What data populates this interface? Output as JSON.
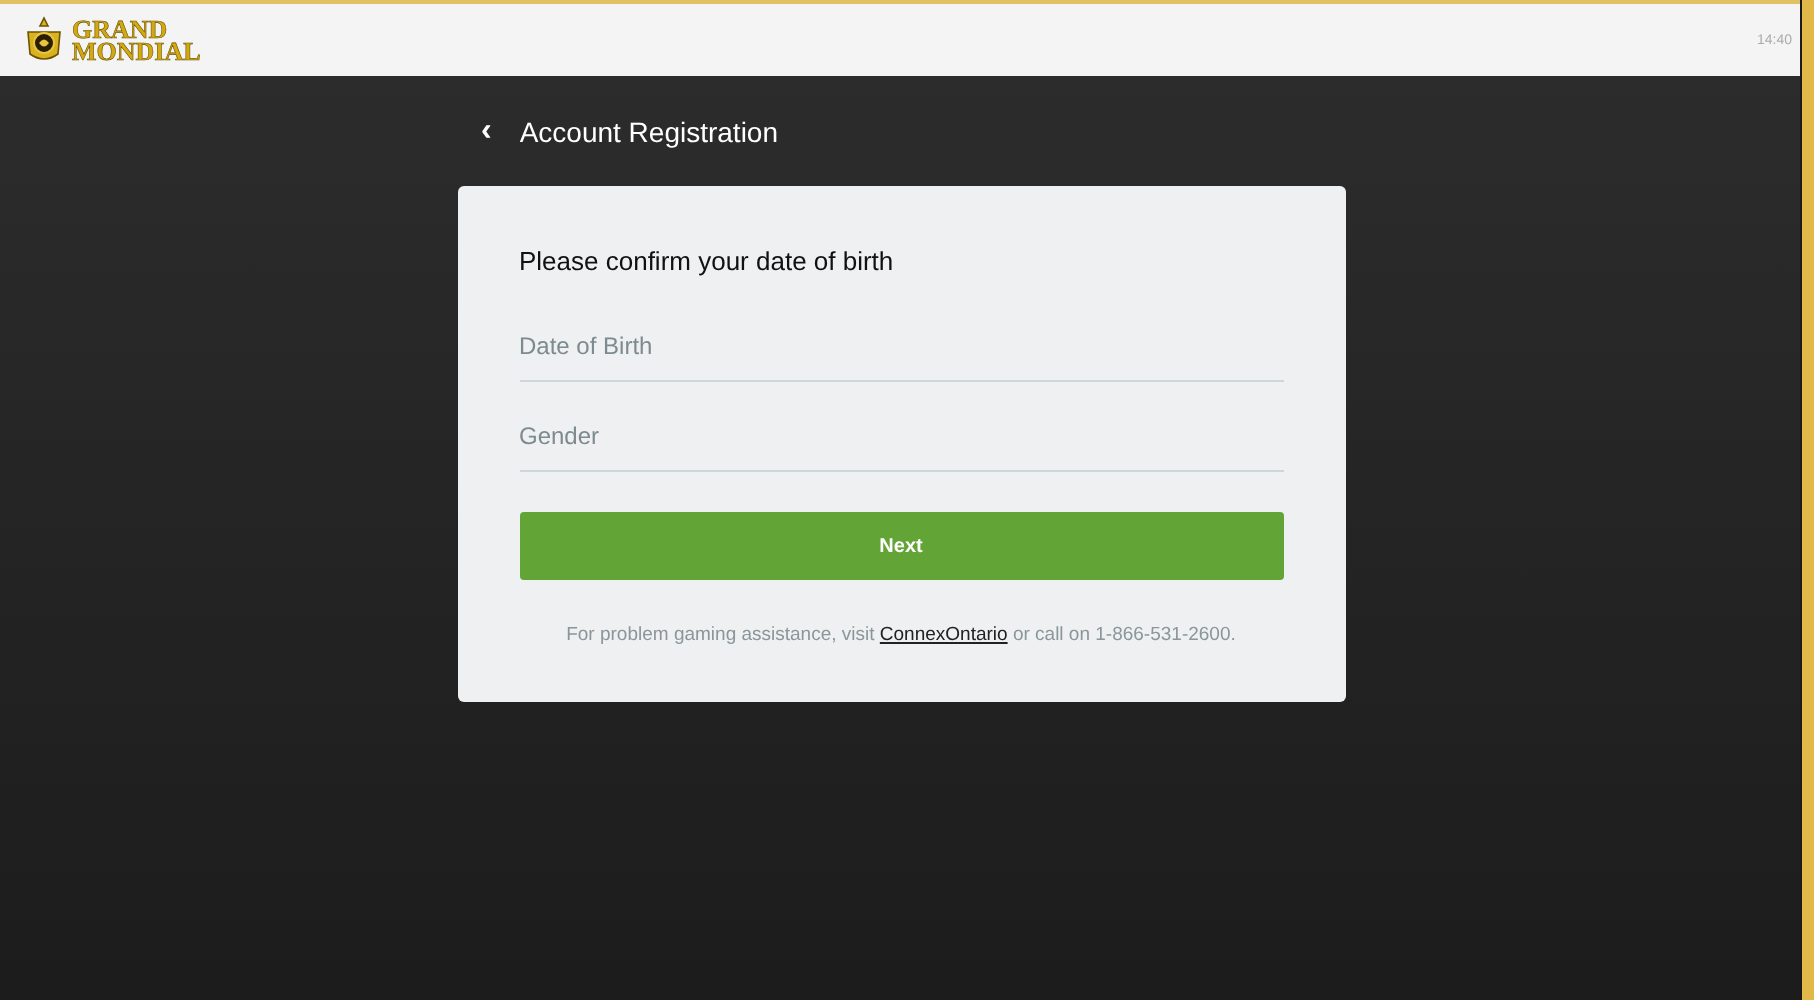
{
  "header": {
    "logo_lines": [
      "GRAND",
      "MONDIAL"
    ],
    "time": "14:40"
  },
  "page": {
    "title": "Account Registration",
    "back": "‹"
  },
  "form": {
    "heading": "Please confirm your date of birth",
    "fields": [
      {
        "placeholder": "Date of Birth"
      },
      {
        "placeholder": "Gender"
      }
    ],
    "button": "Next",
    "notice": {
      "before": "For problem gaming assistance, visit ",
      "link": "ConnexOntario",
      "after": " or call on 1-866-531-2600."
    }
  }
}
